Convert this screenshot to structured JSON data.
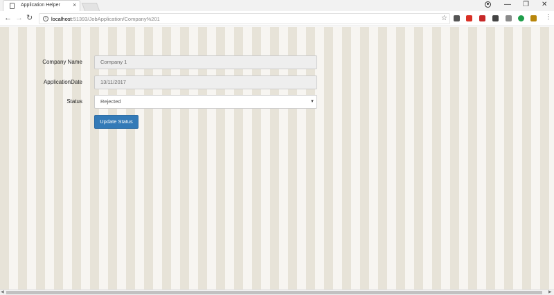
{
  "browser": {
    "tab_title": "Application Helper",
    "tab_close": "×",
    "window_controls": {
      "minimize": "—",
      "restore": "❐",
      "close": "✕"
    },
    "nav": {
      "back": "←",
      "forward": "→",
      "reload": "↻"
    },
    "url_host": "localhost",
    "url_path": ":51393/JobApplication/Company%201",
    "star": "☆",
    "menu": "⋮",
    "extensions": [
      {
        "name": "extension-icon-1",
        "color": "#555555"
      },
      {
        "name": "extension-icon-2",
        "color": "#d93025"
      },
      {
        "name": "extension-icon-3",
        "color": "#c62828"
      },
      {
        "name": "extension-icon-4",
        "color": "#444444"
      },
      {
        "name": "extension-icon-5",
        "color": "#8a8a8a"
      },
      {
        "name": "extension-icon-6",
        "color": "#1e9e4a"
      },
      {
        "name": "extension-icon-7",
        "color": "#b8860b"
      },
      {
        "name": "extension-icon-8",
        "color": "#34a853"
      }
    ]
  },
  "form": {
    "company_name": {
      "label": "Company Name",
      "value": "Company 1"
    },
    "application_date": {
      "label": "ApplicationDate",
      "value": "13/11/2017"
    },
    "status": {
      "label": "Status",
      "value": "Rejected"
    },
    "submit_label": "Update Status"
  },
  "colors": {
    "stripe_dark": "#e7e3d8",
    "stripe_light": "#f7f5f1",
    "button_primary": "#337ab7"
  }
}
